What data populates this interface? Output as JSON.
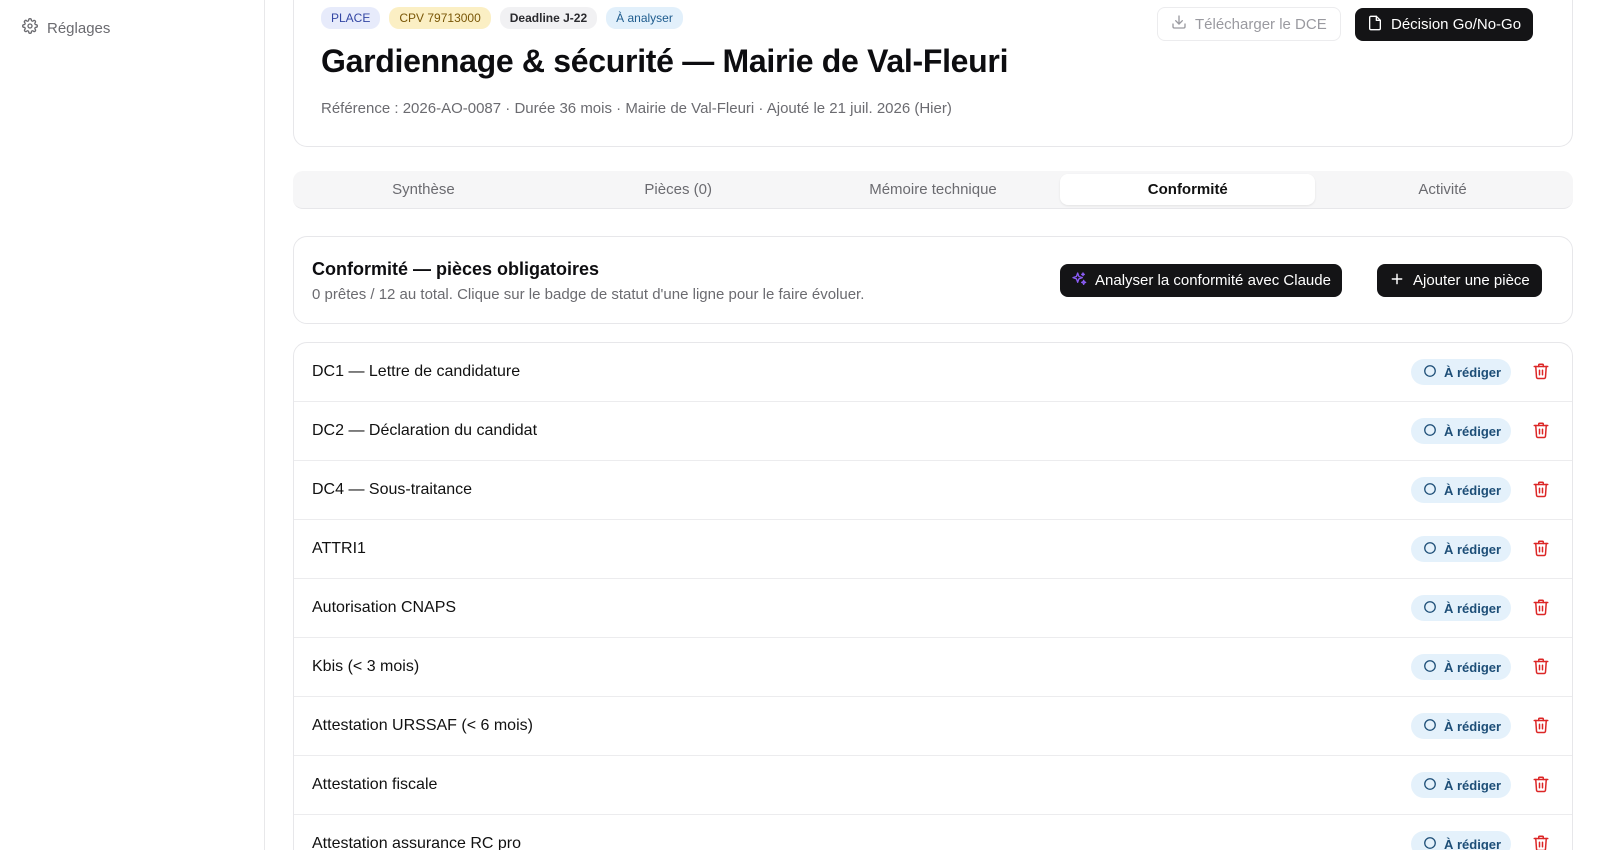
{
  "sidebar": {
    "items": [
      {
        "label": "Réglages",
        "icon": "gear-icon"
      }
    ]
  },
  "header": {
    "badges": {
      "place": "PLACE",
      "cpv": "CPV 79713000",
      "deadline": "Deadline J-22",
      "status": "À analyser"
    },
    "title": "Gardiennage & sécurité — Mairie de Val-Fleuri",
    "meta": "Référence : 2026-AO-0087 · Durée 36 mois · Mairie de Val-Fleuri · Ajouté le 21 juil. 2026 (Hier)",
    "download_label": "Télécharger le DCE",
    "decision_label": "Décision Go/No-Go"
  },
  "tabs": [
    {
      "label": "Synthèse"
    },
    {
      "label": "Pièces (0)"
    },
    {
      "label": "Mémoire technique"
    },
    {
      "label": "Conformité",
      "active": true
    },
    {
      "label": "Activité"
    }
  ],
  "conformite": {
    "title": "Conformité — pièces obligatoires",
    "subtitle": "0 prêtes / 12 au total. Clique sur le badge de statut d'une ligne pour le faire évoluer.",
    "analyse_label": "Analyser la conformité avec Claude",
    "add_label": "Ajouter une pièce",
    "items": [
      {
        "label": "DC1 — Lettre de candidature",
        "status": "À rédiger"
      },
      {
        "label": "DC2 — Déclaration du candidat",
        "status": "À rédiger"
      },
      {
        "label": "DC4 — Sous-traitance",
        "status": "À rédiger"
      },
      {
        "label": "ATTRI1",
        "status": "À rédiger"
      },
      {
        "label": "Autorisation CNAPS",
        "status": "À rédiger"
      },
      {
        "label": "Kbis (< 3 mois)",
        "status": "À rédiger"
      },
      {
        "label": "Attestation URSSAF (< 6 mois)",
        "status": "À rédiger"
      },
      {
        "label": "Attestation fiscale",
        "status": "À rédiger"
      },
      {
        "label": "Attestation assurance RC pro",
        "status": "À rédiger"
      }
    ]
  },
  "colors": {
    "accent_dark": "#141416",
    "status_bg": "#e4f1fb",
    "delete_red": "#dc2626",
    "sparkle": "#8b5cf6"
  }
}
